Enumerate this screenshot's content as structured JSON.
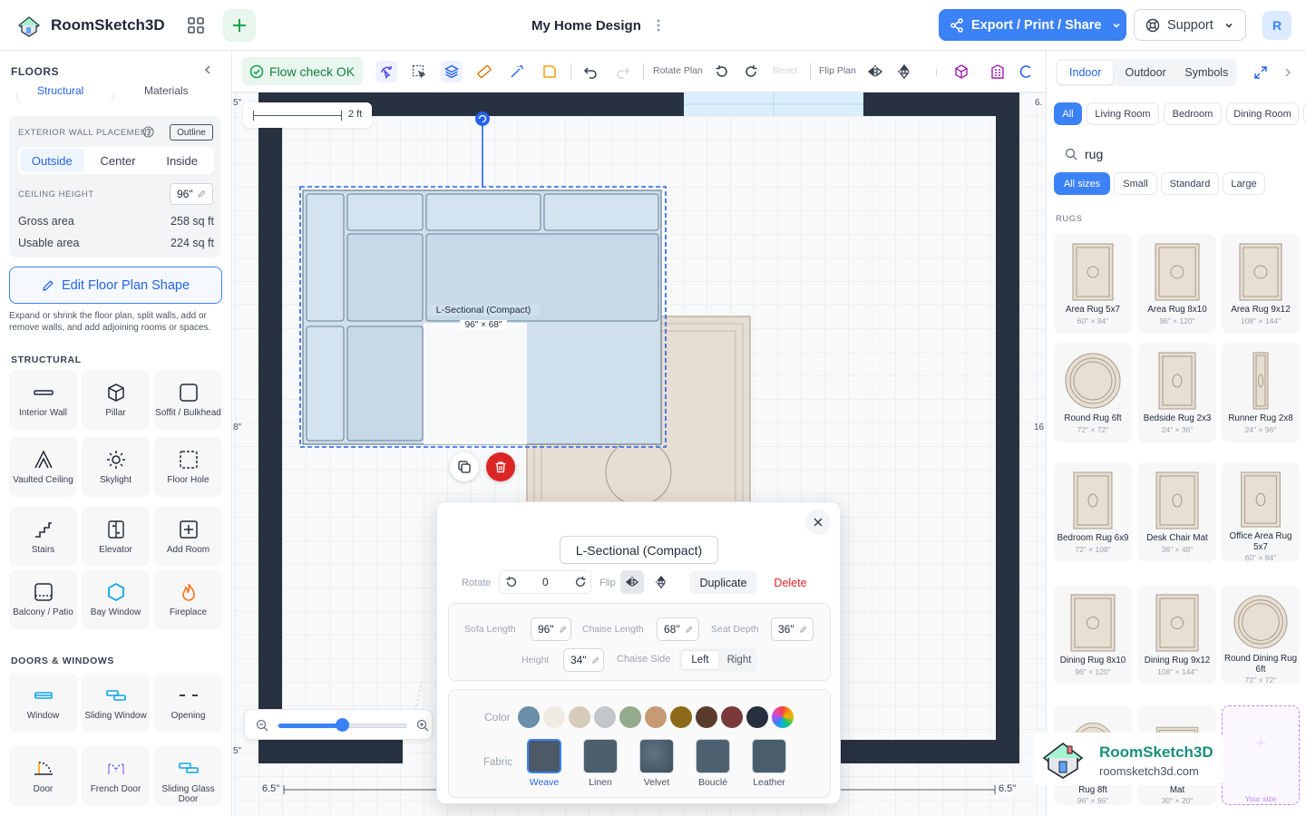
{
  "app": {
    "name": "RoomSketch3D",
    "doc_title": "My Home Design",
    "user_initial": "R"
  },
  "header": {
    "export_label": "Export / Print / Share",
    "support_label": "Support"
  },
  "left": {
    "title": "FLOORS",
    "tabs": [
      "Structural",
      "Materials"
    ],
    "exterior_caption": "EXTERIOR WALL PLACEMENT",
    "outline_badge": "Outline",
    "placement": [
      "Outside",
      "Center",
      "Inside"
    ],
    "ceiling_caption": "CEILING HEIGHT",
    "ceiling_value": "96\"",
    "gross_label": "Gross area",
    "gross_value": "258 sq ft",
    "usable_label": "Usable area",
    "usable_value": "224 sq ft",
    "edit_button": "Edit Floor Plan Shape",
    "edit_desc": "Expand or shrink the floor plan, split walls, add or remove walls, and add adjoining rooms or spaces.",
    "structural_title": "STRUCTURAL",
    "structural": [
      "Interior Wall",
      "Pillar",
      "Soffit / Bulkhead",
      "Vaulted Ceiling",
      "Skylight",
      "Floor Hole",
      "Stairs",
      "Elevator",
      "Add Room",
      "Balcony / Patio",
      "Bay Window",
      "Fireplace"
    ],
    "doors_title": "DOORS & WINDOWS",
    "doors": [
      "Window",
      "Sliding Window",
      "Opening",
      "Door",
      "French Door",
      "Sliding Glass Door"
    ]
  },
  "toolbar": {
    "flow_check": "Flow check OK",
    "rotate_plan": "Rotate Plan",
    "reset": "Reset",
    "flip_plan": "Flip Plan"
  },
  "canvas": {
    "scale_label": "2 ft",
    "sofa_label": "L-Sectional (Compact)",
    "sofa_dims": "96\" × 68\"",
    "dim_left": "6.5\"",
    "dim_right": "6.5\"",
    "edge_5_top": "5\"",
    "edge_6_top": "6.",
    "edge_8": "8\"",
    "edge_16": "16",
    "edge_5_bottom": "5\""
  },
  "popup": {
    "name": "L-Sectional (Compact)",
    "rotate_label": "Rotate",
    "rotate_value": "0",
    "flip_label": "Flip",
    "duplicate": "Duplicate",
    "delete": "Delete",
    "sofa_length_label": "Sofa Length",
    "sofa_length": "96\"",
    "chaise_length_label": "Chaise Length",
    "chaise_length": "68\"",
    "seat_depth_label": "Seat Depth",
    "seat_depth": "36\"",
    "height_label": "Height",
    "height": "34\"",
    "chaise_side_label": "Chaise Side",
    "side_left": "Left",
    "side_right": "Right",
    "color_label": "Color",
    "colors": [
      "#6b8fa8",
      "#efebe3",
      "#d6ccbc",
      "#c3c7cc",
      "#93aa8c",
      "#c69a73",
      "#8d6a1a",
      "#5a3b2c",
      "#7a3a3a",
      "#27303f"
    ],
    "fabric_label": "Fabric",
    "fabrics": [
      "Weave",
      "Linen",
      "Velvet",
      "Bouclé",
      "Leather"
    ]
  },
  "right": {
    "tabs": [
      "Indoor",
      "Outdoor",
      "Symbols"
    ],
    "rooms": [
      "All",
      "Living Room",
      "Bedroom",
      "Dining Room"
    ],
    "search_value": "rug",
    "sizes": [
      "All sizes",
      "Small",
      "Standard",
      "Large"
    ],
    "section": "RUGS",
    "rugs": [
      {
        "name": "Area Rug 5x7",
        "dims": "60\" × 84\""
      },
      {
        "name": "Area Rug 8x10",
        "dims": "96\" × 120\""
      },
      {
        "name": "Area Rug 9x12",
        "dims": "108\" × 144\""
      },
      {
        "name": "Round Rug 6ft",
        "dims": "72\" × 72\""
      },
      {
        "name": "Bedside Rug 2x3",
        "dims": "24\" × 36\""
      },
      {
        "name": "Runner Rug 2x8",
        "dims": "24\" × 96\""
      },
      {
        "name": "Bedroom Rug 6x9",
        "dims": "72\" × 108\""
      },
      {
        "name": "Desk Chair Mat",
        "dims": "36\" × 48\""
      },
      {
        "name": "Office Area Rug 5x7",
        "dims": "60\" × 84\""
      },
      {
        "name": "Dining Rug 8x10",
        "dims": "96\" × 120\""
      },
      {
        "name": "Dining Rug 9x12",
        "dims": "108\" × 144\""
      },
      {
        "name": "Round Dining Rug 6ft",
        "dims": "72\" × 72\""
      }
    ],
    "partial": [
      {
        "name": "Rug 8ft",
        "dims": "96\" × 96\""
      },
      {
        "name": "Mat",
        "dims": "30\" × 20\""
      },
      {
        "name": "Your size"
      }
    ]
  },
  "watermark": {
    "name": "RoomSketch3D",
    "url": "roomsketch3d.com"
  }
}
